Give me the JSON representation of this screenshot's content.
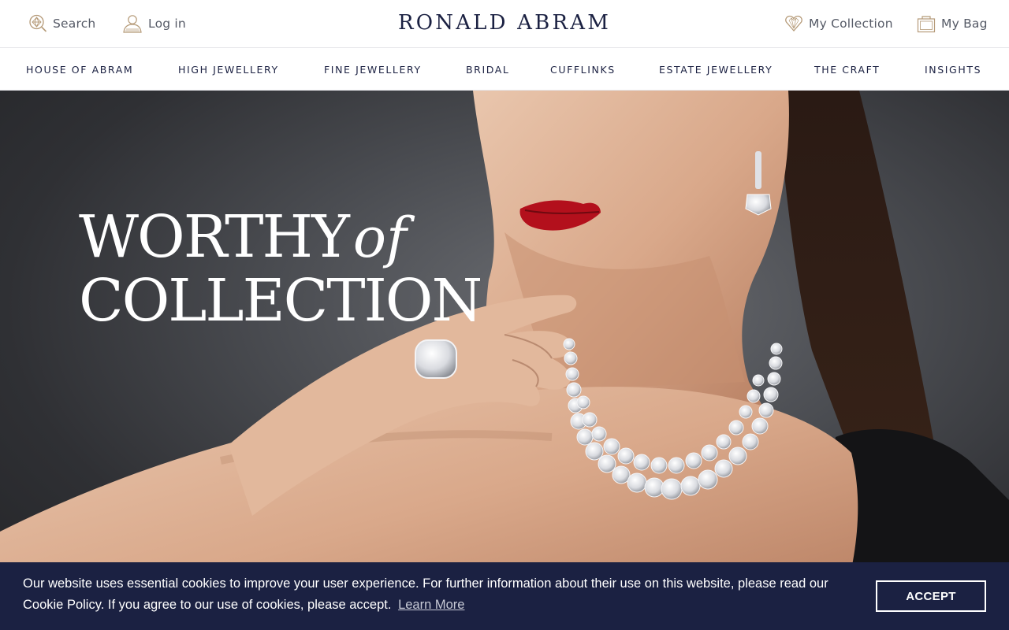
{
  "header": {
    "brand": "RONALD ABRAM",
    "search_label": "Search",
    "login_label": "Log in",
    "collection_label": "My Collection",
    "bag_label": "My Bag",
    "icons": [
      "diamond-search-icon",
      "user-icon",
      "heart-diamond-icon",
      "bag-icon"
    ]
  },
  "nav": {
    "items": [
      {
        "label": "HOUSE OF ABRAM"
      },
      {
        "label": "HIGH JEWELLERY"
      },
      {
        "label": "FINE JEWELLERY"
      },
      {
        "label": "BRIDAL"
      },
      {
        "label": "CUFFLINKS"
      },
      {
        "label": "ESTATE JEWELLERY"
      },
      {
        "label": "THE CRAFT"
      },
      {
        "label": "INSIGHTS"
      }
    ]
  },
  "hero": {
    "headline_word1": "WORTHY",
    "headline_italic": "of",
    "headline_word2": "COLLECTION"
  },
  "cookie_banner": {
    "text": "Our website uses essential cookies to improve your user experience. For further information about their use on this website, please read our Cookie Policy. If you agree to our use of cookies, please accept.",
    "learn_more": "Learn More",
    "accept_label": "ACCEPT"
  },
  "colors": {
    "brand_navy": "#1b2142",
    "banner_bg": "#1b2142",
    "icon_gold": "#b59a78",
    "hero_bg": "#3a3b3f"
  }
}
